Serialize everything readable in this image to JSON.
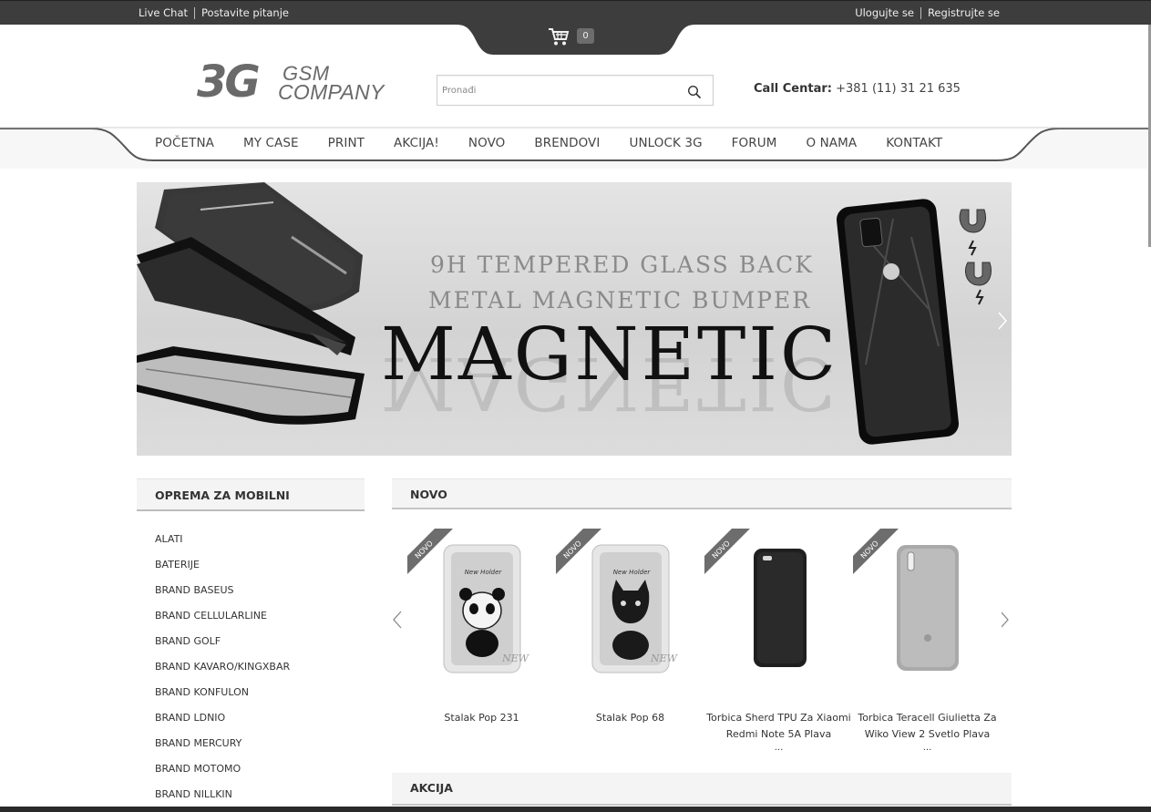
{
  "topbar": {
    "live_chat": "Live Chat",
    "ask_question": "Postavite pitanje",
    "login": "Ulogujte se",
    "register": "Registrujte se"
  },
  "cart": {
    "count": "0",
    "icon": "cart-icon"
  },
  "logo": {
    "big": "3G",
    "line1": "GSM",
    "line2": "COMPANY"
  },
  "search": {
    "placeholder": "Pronađi",
    "icon": "search-icon"
  },
  "callcenter": {
    "label": "Call Centar:",
    "phone": "+381 (11) 31 21 635"
  },
  "nav": {
    "items": [
      "POČETNA",
      "MY CASE",
      "PRINT",
      "AKCIJA!",
      "NOVO",
      "BRENDOVI",
      "UNLOCK 3G",
      "FORUM",
      "O NAMA",
      "KONTAKT"
    ]
  },
  "banner": {
    "line1": "9H TEMPERED GLASS BACK",
    "line2": "METAL MAGNETIC BUMPER",
    "main": "MAGNETIC"
  },
  "sidebar": {
    "title": "OPREMA ZA MOBILNI",
    "items": [
      "ALATI",
      "BATERIJE",
      "BRAND BASEUS",
      "BRAND CELLULARLINE",
      "BRAND GOLF",
      "BRAND KAVARO/KINGXBAR",
      "BRAND KONFULON",
      "BRAND LDNIO",
      "BRAND MERCURY",
      "BRAND MOTOMO",
      "BRAND NILLKIN"
    ]
  },
  "novo": {
    "title": "NOVO",
    "ribbon": "NOVO",
    "products": [
      {
        "name": "Stalak Pop 231",
        "more": "",
        "box_text": "New Holder",
        "side_text": "NEW"
      },
      {
        "name": "Stalak Pop 68",
        "more": "",
        "box_text": "New Holder",
        "side_text": "NEW"
      },
      {
        "name": "Torbica Sherd TPU Za Xiaomi Redmi Note 5A Plava",
        "more": "...",
        "box_text": "",
        "side_text": ""
      },
      {
        "name": "Torbica Teracell Giulietta Za Wiko View 2 Svetlo Plava",
        "more": "...",
        "box_text": "",
        "side_text": ""
      }
    ]
  },
  "akcija": {
    "title": "AKCIJA"
  },
  "colors": {
    "topbar": "#3d3d3d",
    "accent": "#6d6d6d",
    "text": "#333333"
  }
}
